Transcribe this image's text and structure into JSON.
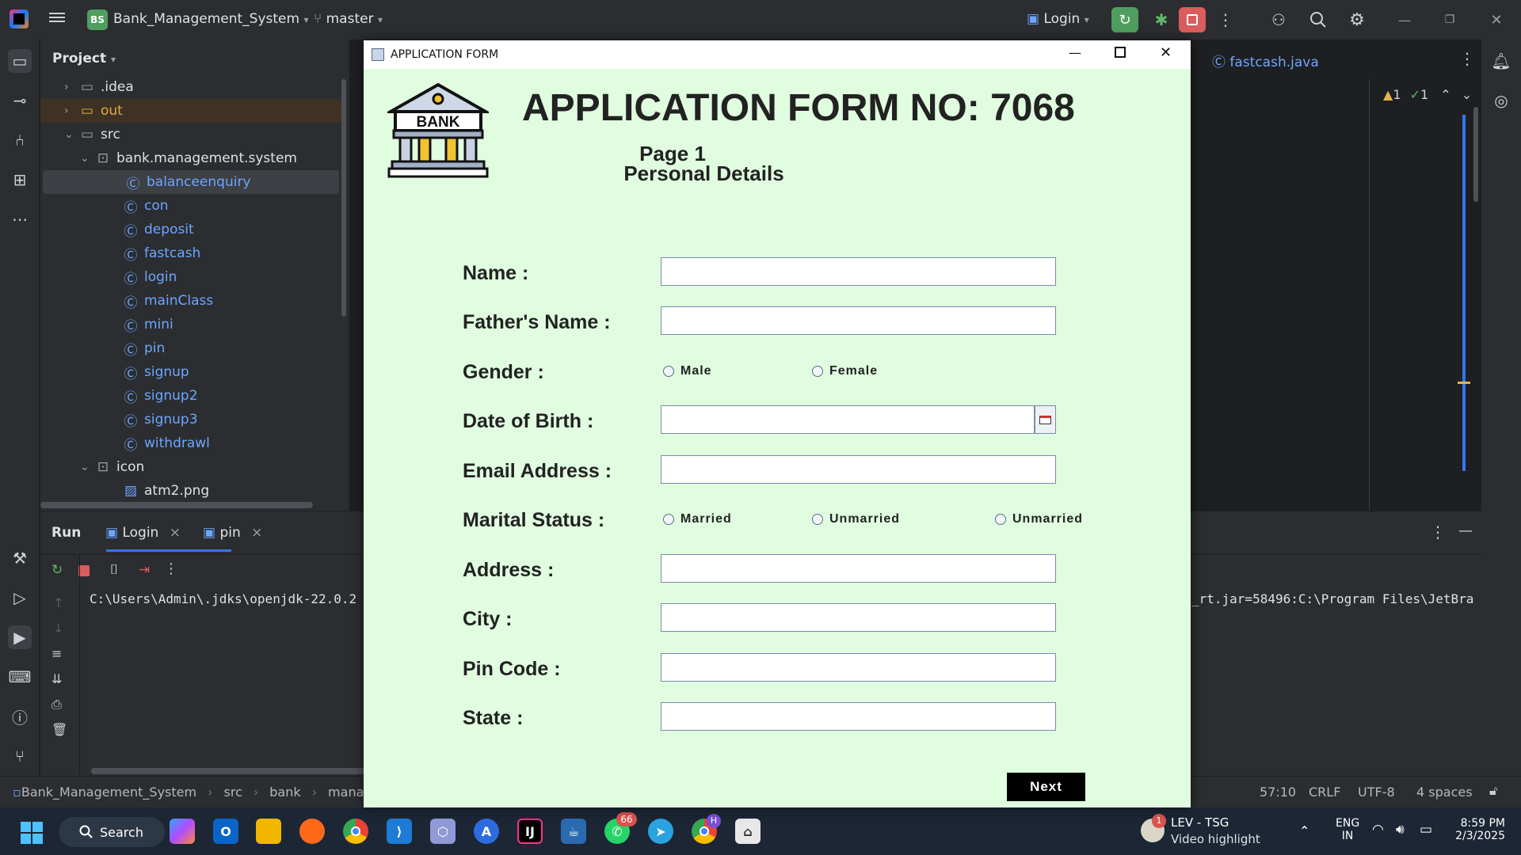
{
  "titlebar": {
    "project_badge": "BS",
    "project_name": "Bank_Management_System",
    "branch": "master",
    "run_config": "Login"
  },
  "project_panel": {
    "title": "Project",
    "tree": [
      {
        "label": ".idea",
        "kind": "folder"
      },
      {
        "label": "out",
        "kind": "folder"
      },
      {
        "label": "src",
        "kind": "folder"
      },
      {
        "label": "bank.management.system",
        "kind": "package"
      },
      {
        "label": "balanceenquiry",
        "kind": "class"
      },
      {
        "label": "con",
        "kind": "class"
      },
      {
        "label": "deposit",
        "kind": "class"
      },
      {
        "label": "fastcash",
        "kind": "class"
      },
      {
        "label": "login",
        "kind": "class"
      },
      {
        "label": "mainClass",
        "kind": "class"
      },
      {
        "label": "mini",
        "kind": "class"
      },
      {
        "label": "pin",
        "kind": "class"
      },
      {
        "label": "signup",
        "kind": "class"
      },
      {
        "label": "signup2",
        "kind": "class"
      },
      {
        "label": "signup3",
        "kind": "class"
      },
      {
        "label": "withdrawl",
        "kind": "class"
      },
      {
        "label": "icon",
        "kind": "package"
      },
      {
        "label": "atm2.png",
        "kind": "image"
      }
    ]
  },
  "editor": {
    "tab": "fastcash.java",
    "warnings": "1",
    "checks": "1"
  },
  "run_panel": {
    "title": "Run",
    "tabs": [
      "Login",
      "pin"
    ],
    "console_left": "C:\\Users\\Admin\\.jdks\\openjdk-22.0.2",
    "console_right": "_rt.jar=58496:C:\\Program Files\\JetBra"
  },
  "statusbar": {
    "breadcrumb": [
      "Bank_Management_System",
      "src",
      "bank",
      "manage"
    ],
    "position": "57:10",
    "line_ending": "CRLF",
    "encoding": "UTF-8",
    "indent": "4 spaces"
  },
  "app_window": {
    "title": "APPLICATION FORM",
    "logo_text": "BANK",
    "heading": "APPLICATION FORM NO: 7068",
    "page": "Page 1",
    "section": "Personal Details",
    "labels": {
      "name": "Name :",
      "father": "Father's Name :",
      "gender": "Gender :",
      "dob": "Date of Birth :",
      "email": "Email Address :",
      "marital": "Marital Status :",
      "address": "Address :",
      "city": "City :",
      "pin": "Pin Code :",
      "state": "State :"
    },
    "gender_options": [
      "Male",
      "Female"
    ],
    "marital_options": [
      "Married",
      "Unmarried",
      "Unmarried"
    ],
    "next_label": "Next"
  },
  "taskbar": {
    "search": "Search",
    "whatsapp_badge": "66",
    "chrome_badge": "H",
    "news_badge": "1",
    "news_title": "LEV - TSG",
    "news_sub": "Video highlight",
    "lang1": "ENG",
    "lang2": "IN",
    "time": "8:59 PM",
    "date": "2/3/2025"
  }
}
